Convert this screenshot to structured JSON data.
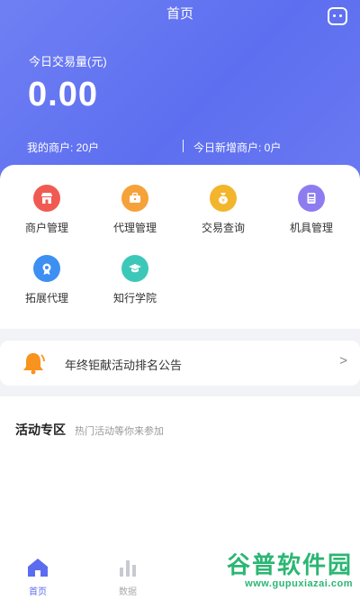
{
  "header": {
    "title": "首页",
    "volume_label": "今日交易量(元)",
    "volume_value": "0.00",
    "my_merchants": "我的商户: 20户",
    "new_merchants": "今日新增商户: 0户"
  },
  "menu": [
    {
      "label": "商户管理",
      "icon": "store-icon",
      "color": "#f05a52"
    },
    {
      "label": "代理管理",
      "icon": "briefcase-icon",
      "color": "#f5a23a"
    },
    {
      "label": "交易查询",
      "icon": "money-bag-icon",
      "color": "#f3b52b"
    },
    {
      "label": "机具管理",
      "icon": "device-icon",
      "color": "#8d7cf0"
    },
    {
      "label": "拓展代理",
      "icon": "badge-icon",
      "color": "#3d8ff2"
    },
    {
      "label": "知行学院",
      "icon": "graduation-cap-icon",
      "color": "#3cc8b9"
    }
  ],
  "notice": {
    "text": "年终钜献活动排名公告",
    "arrow": ">"
  },
  "activity": {
    "title": "活动专区",
    "subtitle": "热门活动等你来参加"
  },
  "tabbar": [
    {
      "label": "首页",
      "active": true
    },
    {
      "label": "数据",
      "active": false
    }
  ],
  "watermark": {
    "brand": "谷普软件园",
    "url": "www.gupuxiazai.com"
  },
  "colors": {
    "primary": "#5d6ff0",
    "background": "#f2f3f7"
  }
}
